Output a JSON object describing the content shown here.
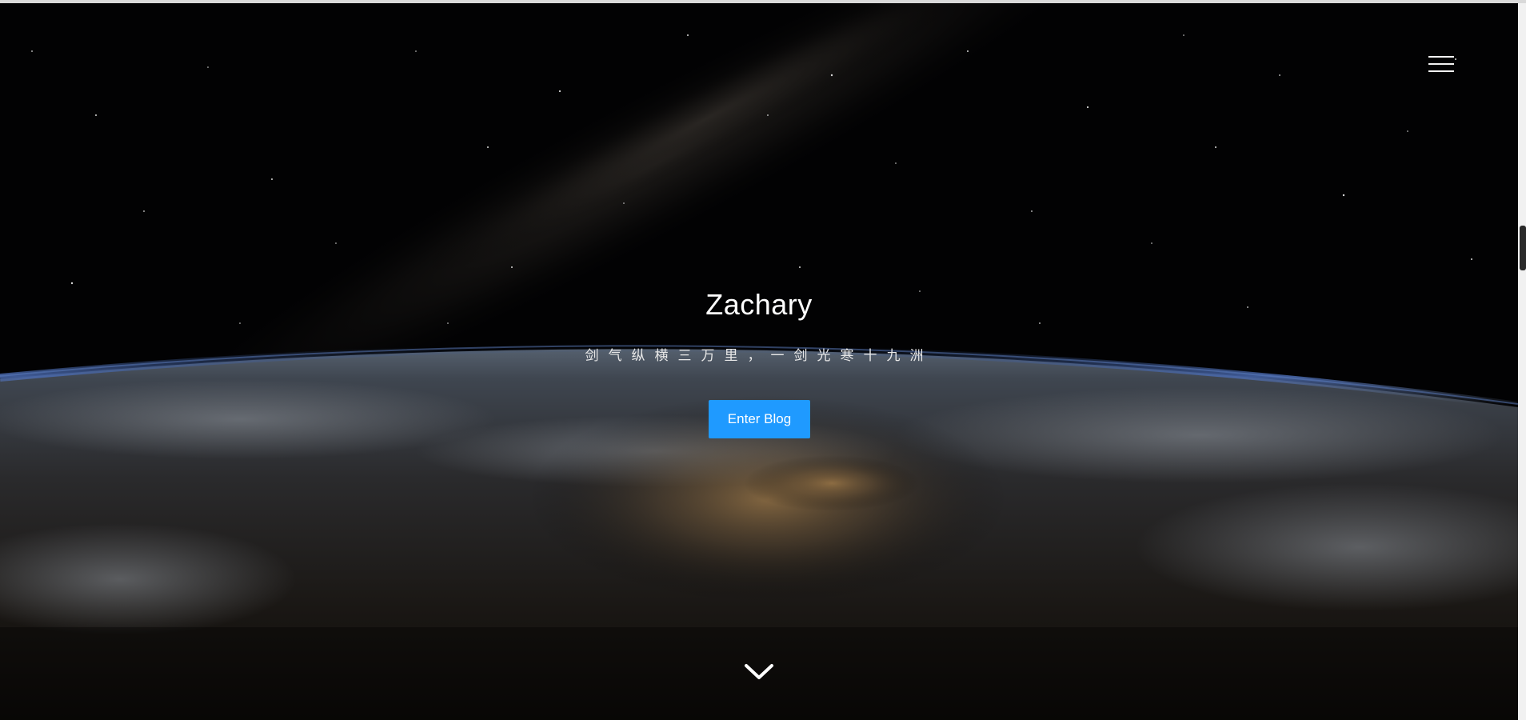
{
  "hero": {
    "title": "Zachary",
    "subtitle": "剑气纵横三万里，一剑光寒十九洲",
    "enter_button_label": "Enter Blog"
  },
  "icons": {
    "menu": "hamburger-menu-icon",
    "scroll": "chevron-down-icon"
  },
  "colors": {
    "accent": "#1f9aff",
    "text": "#ffffff",
    "background": "#020203"
  }
}
